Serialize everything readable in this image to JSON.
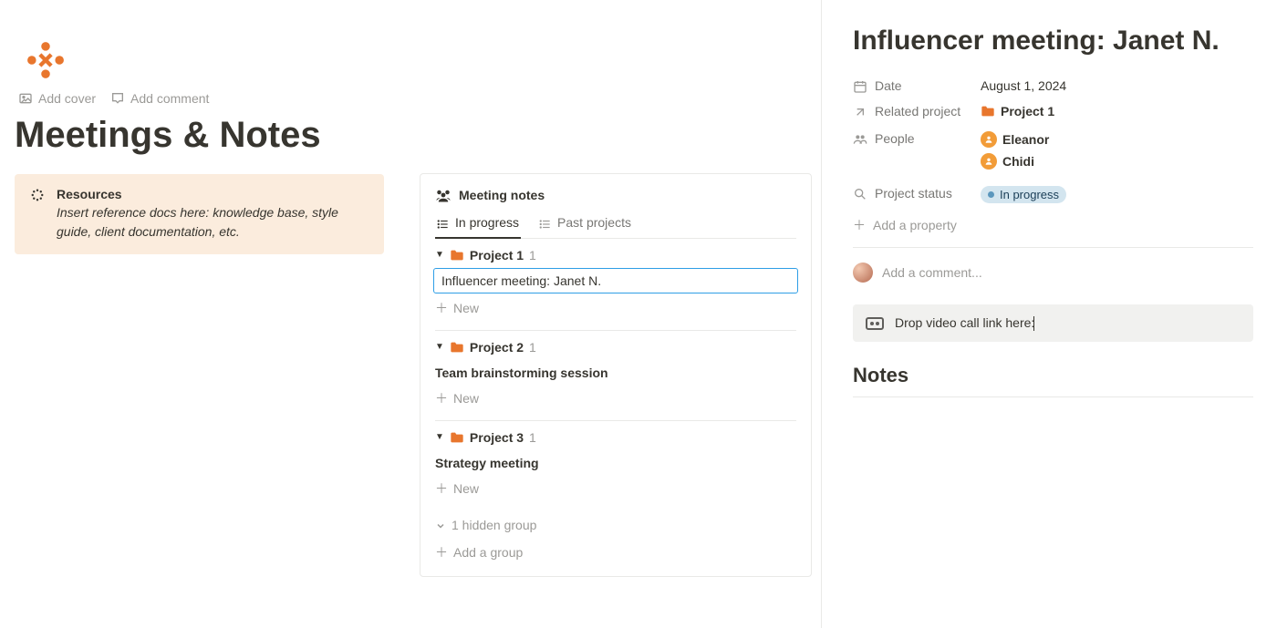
{
  "page": {
    "title": "Meetings & Notes",
    "add_cover": "Add cover",
    "add_comment": "Add comment"
  },
  "callout": {
    "title": "Resources",
    "text": "Insert reference docs here: knowledge base, style guide, client documentation, etc."
  },
  "notes_card": {
    "heading": "Meeting notes",
    "tabs": {
      "in_progress": "In progress",
      "past": "Past projects"
    },
    "groups": [
      {
        "name": "Project 1",
        "count": "1",
        "items": [
          "Influencer meeting: Janet N."
        ]
      },
      {
        "name": "Project 2",
        "count": "1",
        "items": [
          "Team brainstorming session"
        ]
      },
      {
        "name": "Project 3",
        "count": "1",
        "items": [
          "Strategy meeting"
        ]
      }
    ],
    "new_label": "New",
    "hidden_group": "1 hidden group",
    "add_group": "Add a group"
  },
  "side": {
    "title": "Influencer meeting: Janet N.",
    "labels": {
      "date": "Date",
      "related": "Related project",
      "people": "People",
      "status": "Project status",
      "add_prop": "Add a property",
      "comment_placeholder": "Add a comment...",
      "video_text": "Drop video call link here:",
      "notes_heading": "Notes"
    },
    "date": "August 1, 2024",
    "related_project": "Project 1",
    "people": [
      "Eleanor",
      "Chidi"
    ],
    "status": "In progress"
  }
}
